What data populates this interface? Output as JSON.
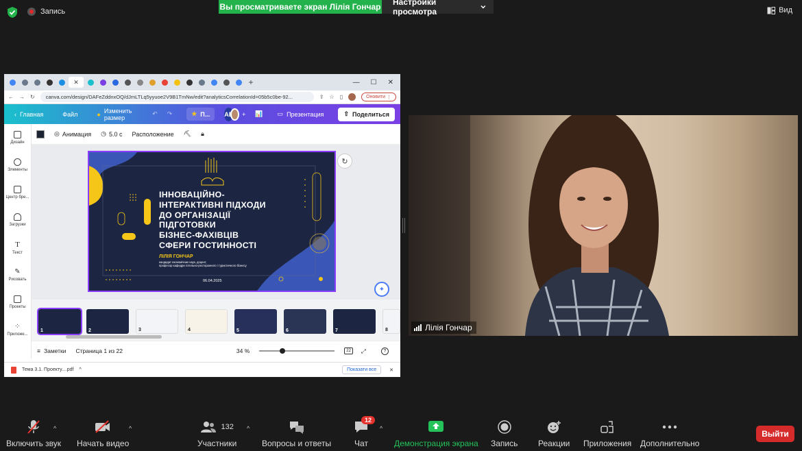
{
  "topbar": {
    "recording_label": "Запись",
    "share_banner": "Вы просматриваете экран Лілія Гончар",
    "view_options": "Настройки просмотра",
    "view_button": "Вид"
  },
  "browser": {
    "url": "canva.com/design/DAFeZddnxOQ/dJmLTLq5yyuoe2V9B1TmNw/edit?analyticsCorrelationId=05b5c0be-92...",
    "update_button": "Оновити",
    "canva_bar": {
      "home": "Главная",
      "file": "Файл",
      "resize": "Изменить размер",
      "project": "П...",
      "avatar_initials": "АБ",
      "present": "Презентация",
      "share": "Поделиться"
    },
    "toolbar": {
      "animation": "Анимация",
      "duration": "5.0 с",
      "position": "Расположение"
    },
    "left_rail": [
      "Дизайн",
      "Элементы",
      "Центр бре...",
      "Загрузки",
      "Текст",
      "Рисовать",
      "Проекты",
      "Приложе..."
    ],
    "slide": {
      "title_lines": [
        "ІННОВАЦІЙНО-",
        "ІНТЕРАКТИВНІ ПІДХОДИ",
        "ДО ОРГАНІЗАЦІЇ",
        "ПІДГОТОВКИ",
        "БІЗНЕС-ФАХІВЦІВ",
        "СФЕРИ ГОСТИННОСТІ"
      ],
      "author": "ЛІЛІЯ ГОНЧАР",
      "subtitle_1": "кандидат економічних наук, доцент,",
      "subtitle_2": "професор кафедри готельно-ресторанного і туристичного бізнесу",
      "date": "06.04.2025"
    },
    "thumbnails": [
      "1",
      "2",
      "3",
      "4",
      "5",
      "6",
      "7",
      "8"
    ],
    "bottom": {
      "notes": "Заметки",
      "page": "Страница 1 из 22",
      "zoom": "34 %",
      "page_count_icon": "22"
    },
    "downloads": {
      "file": "Тема 3.1. Проекту....pdf",
      "show_all": "Показати все"
    }
  },
  "camera": {
    "participant_name": "Лілія Гончар"
  },
  "footer": {
    "mute": "Включить звук",
    "video": "Начать видео",
    "participants": "Участники",
    "participants_count": "132",
    "qa": "Вопросы и ответы",
    "chat": "Чат",
    "chat_badge": "12",
    "share_screen": "Демонстрация экрана",
    "record": "Запись",
    "reactions": "Реакции",
    "apps": "Приложения",
    "more": "Дополнительно",
    "leave": "Выйти"
  },
  "colors": {
    "share_green": "#23b24b",
    "leave_red": "#d52b2b",
    "canva_purple": "#7b3fe4",
    "slide_navy": "#1c2643",
    "slide_yellow": "#f5c518"
  }
}
